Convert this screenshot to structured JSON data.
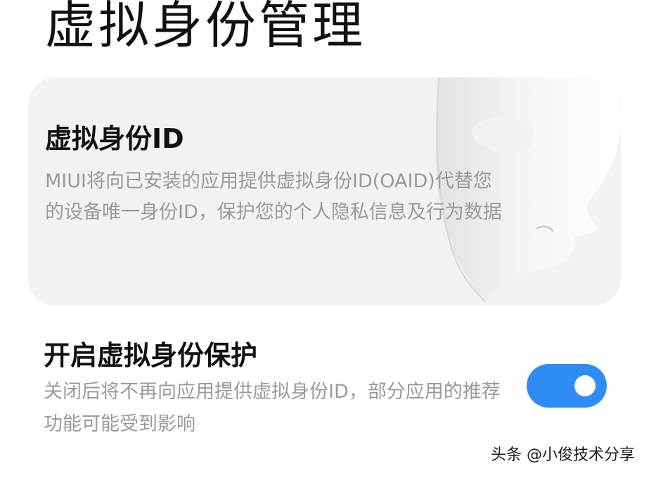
{
  "page": {
    "title": "虚拟身份管理"
  },
  "info_card": {
    "title": "虚拟身份ID",
    "description": "MIUI将向已安装的应用提供虚拟身份ID(OAID)代替您的设备唯一身份ID，保护您的个人隐私信息及行为数据",
    "illustration": "mask-icon"
  },
  "setting": {
    "title": "开启虚拟身份保护",
    "description": "关闭后将不再向应用提供虚拟身份ID，部分应用的推荐功能可能受到影响",
    "enabled": true
  },
  "watermark": {
    "text": "头条 @小俊技术分享"
  },
  "colors": {
    "accent": "#2f8cf5",
    "card_background": "#f2f2f2",
    "secondary_text": "#9a9a9a"
  }
}
